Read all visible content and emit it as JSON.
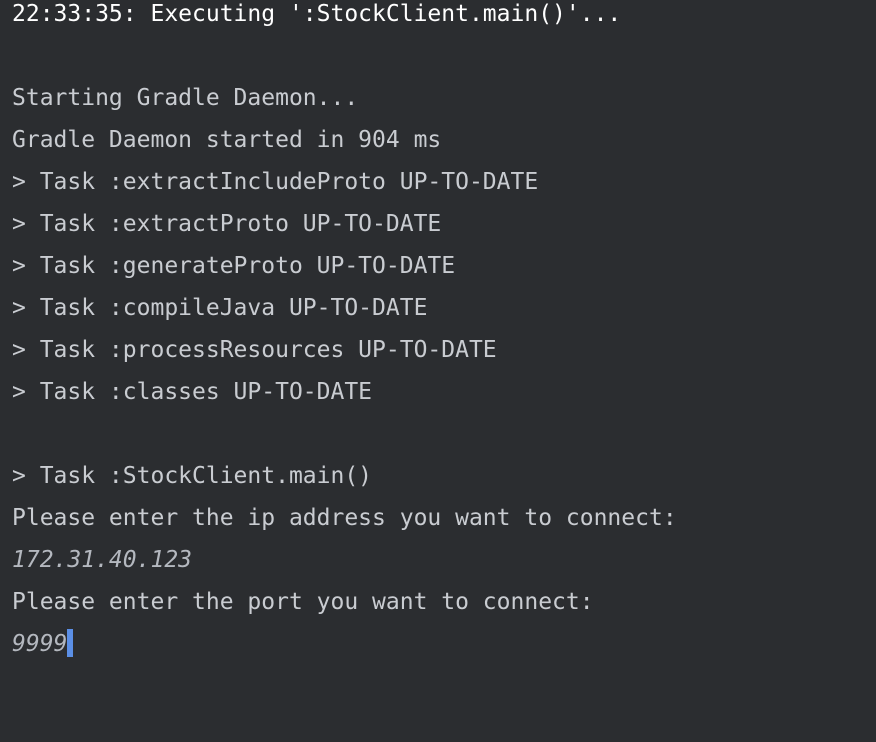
{
  "console": {
    "header": "22:33:35: Executing ':StockClient.main()'...",
    "lines": [
      "",
      "Starting Gradle Daemon...",
      "Gradle Daemon started in 904 ms",
      "> Task :extractIncludeProto UP-TO-DATE",
      "> Task :extractProto UP-TO-DATE",
      "> Task :generateProto UP-TO-DATE",
      "> Task :compileJava UP-TO-DATE",
      "> Task :processResources UP-TO-DATE",
      "> Task :classes UP-TO-DATE",
      "",
      "> Task :StockClient.main()",
      "Please enter the ip address you want to connect:"
    ],
    "ip_input": "172.31.40.123",
    "port_prompt": "Please enter the port you want to connect:",
    "port_input": "9999"
  },
  "colors": {
    "background": "#2b2d30",
    "text": "#c9ccd1",
    "cursor": "#5b8fe6"
  }
}
